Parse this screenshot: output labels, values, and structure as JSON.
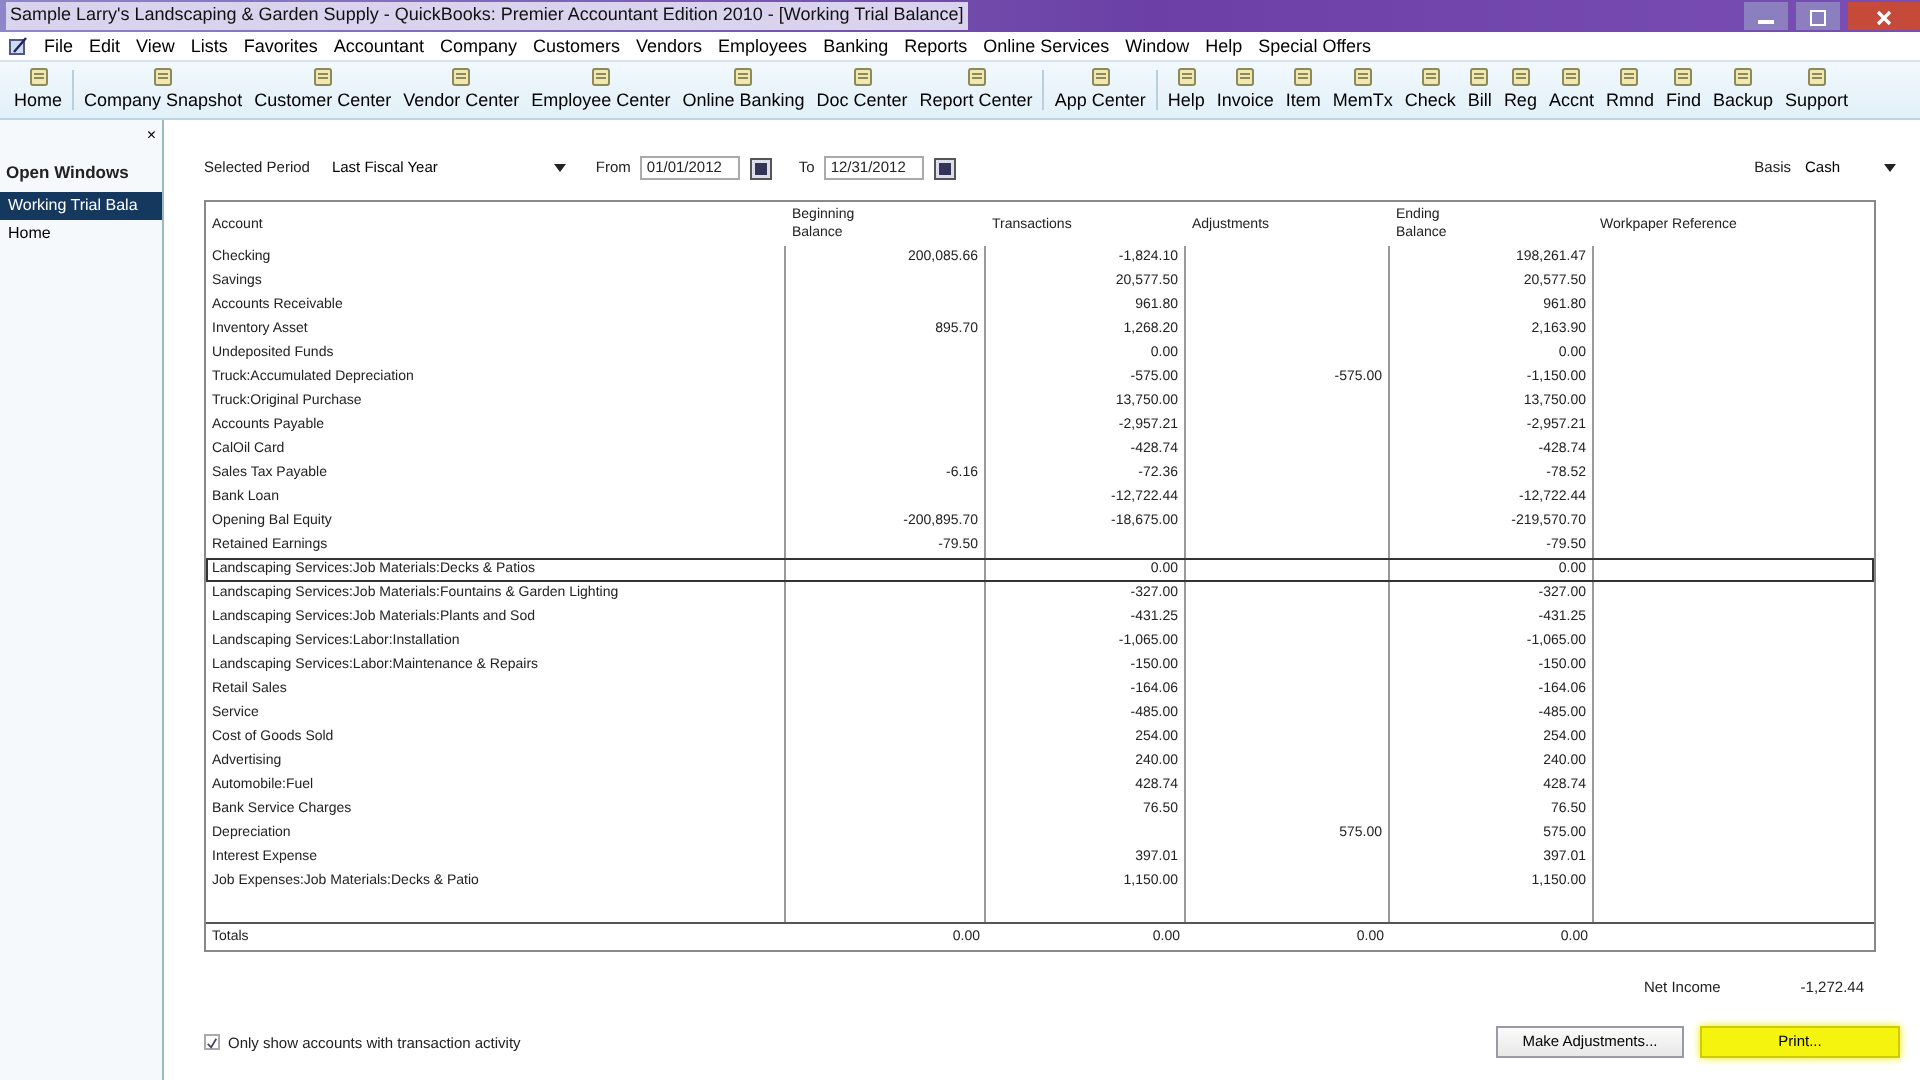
{
  "window": {
    "title": "Sample Larry's Landscaping & Garden Supply  - QuickBooks: Premier Accountant Edition 2010 - [Working Trial Balance]"
  },
  "menu": [
    "File",
    "Edit",
    "View",
    "Lists",
    "Favorites",
    "Accountant",
    "Company",
    "Customers",
    "Vendors",
    "Employees",
    "Banking",
    "Reports",
    "Online Services",
    "Window",
    "Help",
    "Special Offers"
  ],
  "toolbar": [
    {
      "label": "Home",
      "separator_after": true
    },
    {
      "label": "Company Snapshot",
      "separator_after": false
    },
    {
      "label": "Customer Center",
      "separator_after": false
    },
    {
      "label": "Vendor Center",
      "separator_after": false
    },
    {
      "label": "Employee Center",
      "separator_after": false
    },
    {
      "label": "Online Banking",
      "separator_after": false
    },
    {
      "label": "Doc Center",
      "separator_after": false
    },
    {
      "label": "Report Center",
      "separator_after": true
    },
    {
      "label": "App Center",
      "separator_after": true
    },
    {
      "label": "Help",
      "separator_after": false
    },
    {
      "label": "Invoice",
      "separator_after": false
    },
    {
      "label": "Item",
      "separator_after": false
    },
    {
      "label": "MemTx",
      "separator_after": false
    },
    {
      "label": "Check",
      "separator_after": false
    },
    {
      "label": "Bill",
      "separator_after": false
    },
    {
      "label": "Reg",
      "separator_after": false
    },
    {
      "label": "Accnt",
      "separator_after": false
    },
    {
      "label": "Rmnd",
      "separator_after": false
    },
    {
      "label": "Find",
      "separator_after": false
    },
    {
      "label": "Backup",
      "separator_after": false
    },
    {
      "label": "Support",
      "separator_after": false
    }
  ],
  "open_windows": {
    "title": "Open Windows",
    "close": "×",
    "items": [
      {
        "label": "Working Trial Bala",
        "selected": true
      },
      {
        "label": "Home",
        "selected": false
      }
    ]
  },
  "filters": {
    "period": {
      "label": "Selected Period",
      "value": "Last Fiscal Year"
    },
    "from": {
      "label": "From",
      "value": "01/01/2012"
    },
    "to": {
      "label": "To",
      "value": "12/31/2012"
    },
    "basis": {
      "label": "Basis",
      "value": "Cash"
    }
  },
  "table": {
    "columns": [
      "Account",
      "Beginning Balance",
      "Transactions",
      "Adjustments",
      "Ending Balance",
      "Workpaper Reference"
    ],
    "rows": [
      {
        "account": "Checking",
        "beginning_balance": "200,085.66",
        "transactions": "-1,824.10",
        "adjustments": "",
        "ending_balance": "198,261.47",
        "selected": false
      },
      {
        "account": "Savings",
        "beginning_balance": "",
        "transactions": "20,577.50",
        "adjustments": "",
        "ending_balance": "20,577.50",
        "selected": false
      },
      {
        "account": "Accounts Receivable",
        "beginning_balance": "",
        "transactions": "961.80",
        "adjustments": "",
        "ending_balance": "961.80",
        "selected": false
      },
      {
        "account": "Inventory Asset",
        "beginning_balance": "895.70",
        "transactions": "1,268.20",
        "adjustments": "",
        "ending_balance": "2,163.90",
        "selected": false
      },
      {
        "account": "Undeposited Funds",
        "beginning_balance": "",
        "transactions": "0.00",
        "adjustments": "",
        "ending_balance": "0.00",
        "selected": false
      },
      {
        "account": "Truck:Accumulated Depreciation",
        "beginning_balance": "",
        "transactions": "-575.00",
        "adjustments": "-575.00",
        "ending_balance": "-1,150.00",
        "selected": false
      },
      {
        "account": "Truck:Original Purchase",
        "beginning_balance": "",
        "transactions": "13,750.00",
        "adjustments": "",
        "ending_balance": "13,750.00",
        "selected": false
      },
      {
        "account": "Accounts Payable",
        "beginning_balance": "",
        "transactions": "-2,957.21",
        "adjustments": "",
        "ending_balance": "-2,957.21",
        "selected": false
      },
      {
        "account": "CalOil Card",
        "beginning_balance": "",
        "transactions": "-428.74",
        "adjustments": "",
        "ending_balance": "-428.74",
        "selected": false
      },
      {
        "account": "Sales Tax Payable",
        "beginning_balance": "-6.16",
        "transactions": "-72.36",
        "adjustments": "",
        "ending_balance": "-78.52",
        "selected": false
      },
      {
        "account": "Bank Loan",
        "beginning_balance": "",
        "transactions": "-12,722.44",
        "adjustments": "",
        "ending_balance": "-12,722.44",
        "selected": false
      },
      {
        "account": "Opening Bal Equity",
        "beginning_balance": "-200,895.70",
        "transactions": "-18,675.00",
        "adjustments": "",
        "ending_balance": "-219,570.70",
        "selected": false
      },
      {
        "account": "Retained Earnings",
        "beginning_balance": "-79.50",
        "transactions": "",
        "adjustments": "",
        "ending_balance": "-79.50",
        "selected": false
      },
      {
        "account": "Landscaping Services:Job Materials:Decks & Patios",
        "beginning_balance": "",
        "transactions": "0.00",
        "adjustments": "",
        "ending_balance": "0.00",
        "selected": true
      },
      {
        "account": "Landscaping Services:Job Materials:Fountains & Garden Lighting",
        "beginning_balance": "",
        "transactions": "-327.00",
        "adjustments": "",
        "ending_balance": "-327.00",
        "selected": false
      },
      {
        "account": "Landscaping Services:Job Materials:Plants and Sod",
        "beginning_balance": "",
        "transactions": "-431.25",
        "adjustments": "",
        "ending_balance": "-431.25",
        "selected": false
      },
      {
        "account": "Landscaping Services:Labor:Installation",
        "beginning_balance": "",
        "transactions": "-1,065.00",
        "adjustments": "",
        "ending_balance": "-1,065.00",
        "selected": false
      },
      {
        "account": "Landscaping Services:Labor:Maintenance & Repairs",
        "beginning_balance": "",
        "transactions": "-150.00",
        "adjustments": "",
        "ending_balance": "-150.00",
        "selected": false
      },
      {
        "account": "Retail Sales",
        "beginning_balance": "",
        "transactions": "-164.06",
        "adjustments": "",
        "ending_balance": "-164.06",
        "selected": false
      },
      {
        "account": "Service",
        "beginning_balance": "",
        "transactions": "-485.00",
        "adjustments": "",
        "ending_balance": "-485.00",
        "selected": false
      },
      {
        "account": "Cost of Goods Sold",
        "beginning_balance": "",
        "transactions": "254.00",
        "adjustments": "",
        "ending_balance": "254.00",
        "selected": false
      },
      {
        "account": "Advertising",
        "beginning_balance": "",
        "transactions": "240.00",
        "adjustments": "",
        "ending_balance": "240.00",
        "selected": false
      },
      {
        "account": "Automobile:Fuel",
        "beginning_balance": "",
        "transactions": "428.74",
        "adjustments": "",
        "ending_balance": "428.74",
        "selected": false
      },
      {
        "account": "Bank Service Charges",
        "beginning_balance": "",
        "transactions": "76.50",
        "adjustments": "",
        "ending_balance": "76.50",
        "selected": false
      },
      {
        "account": "Depreciation",
        "beginning_balance": "",
        "transactions": "",
        "adjustments": "575.00",
        "ending_balance": "575.00",
        "selected": false
      },
      {
        "account": "Interest Expense",
        "beginning_balance": "",
        "transactions": "397.01",
        "adjustments": "",
        "ending_balance": "397.01",
        "selected": false
      },
      {
        "account": "Job Expenses:Job Materials:Decks & Patio",
        "beginning_balance": "",
        "transactions": "1,150.00",
        "adjustments": "",
        "ending_balance": "1,150.00",
        "selected": false
      }
    ],
    "totals": {
      "label": "Totals",
      "beginning_balance": "0.00",
      "transactions": "0.00",
      "adjustments": "0.00",
      "ending_balance": "0.00"
    }
  },
  "net_income": {
    "label": "Net Income",
    "value": "-1,272.44"
  },
  "only_active": {
    "label": "Only show accounts with transaction activity",
    "checked": true
  },
  "buttons": [
    {
      "label": "Make Adjustments...",
      "highlighted": false
    },
    {
      "label": "Print...",
      "highlighted": true
    }
  ]
}
